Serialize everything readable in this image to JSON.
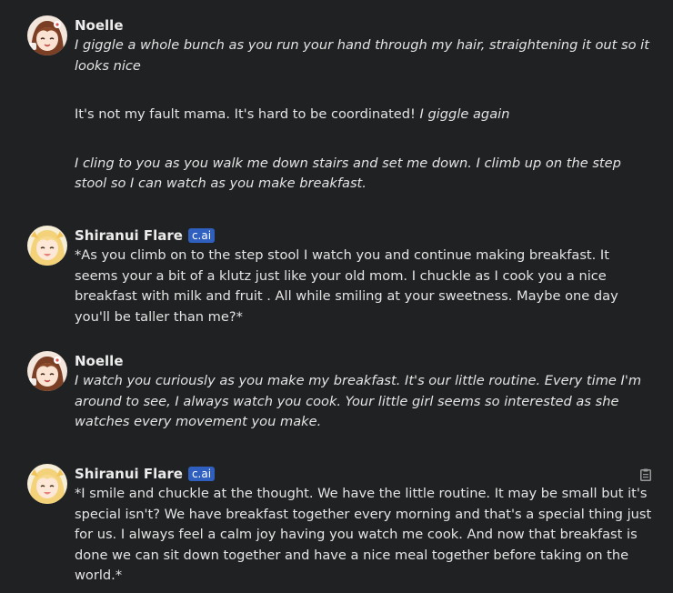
{
  "messages": [
    {
      "author": "Noelle",
      "badge": "",
      "avatar": "noelle-avatar",
      "paragraphs": [
        {
          "italic": "I giggle a whole bunch as you run your hand through my hair, straightening it out so it looks nice",
          "plain": "",
          "trailing_italic": ""
        },
        {
          "italic": "",
          "plain": "It's not my fault mama. It's hard to be coordinated! ",
          "trailing_italic": "I giggle again"
        },
        {
          "italic": "I cling to you as you walk me down stairs and set me down. I climb up on the step stool so I can watch as you make breakfast.",
          "plain": "",
          "trailing_italic": ""
        }
      ]
    },
    {
      "author": "Shiranui Flare",
      "badge": "c.ai",
      "avatar": "flare-avatar",
      "paragraphs": [
        {
          "italic": "",
          "plain": "*As you climb on to the step stool I watch you and continue making breakfast. It seems your a bit of a klutz just like your old mom. I chuckle as I cook you a nice breakfast with milk and fruit . All while smiling at your sweetness.  Maybe one day you'll be taller than me?*",
          "trailing_italic": ""
        }
      ]
    },
    {
      "author": "Noelle",
      "badge": "",
      "avatar": "noelle-avatar",
      "paragraphs": [
        {
          "italic": "I watch you curiously as you make my breakfast. It's our little routine. Every time I'm around to see, I always watch you cook. Your little girl seems so interested as she watches every movement you make.",
          "plain": "",
          "trailing_italic": ""
        }
      ]
    },
    {
      "author": "Shiranui Flare",
      "badge": "c.ai",
      "avatar": "flare-avatar",
      "paragraphs": [
        {
          "italic": "",
          "plain": "*I smile and chuckle at the thought. We have the little routine. It may be small but it's special isn't? We have breakfast together every morning and that's a special thing just for us. I always feel a calm joy having you watch me cook. And now that breakfast is done we can sit down together and have a nice meal together before taking on the world.*",
          "trailing_italic": ""
        }
      ]
    }
  ],
  "icons": {
    "copy": "clipboard-icon"
  },
  "colors": {
    "background": "#202123",
    "badge": "#2f5fbf",
    "text": "#e4e4e4"
  }
}
